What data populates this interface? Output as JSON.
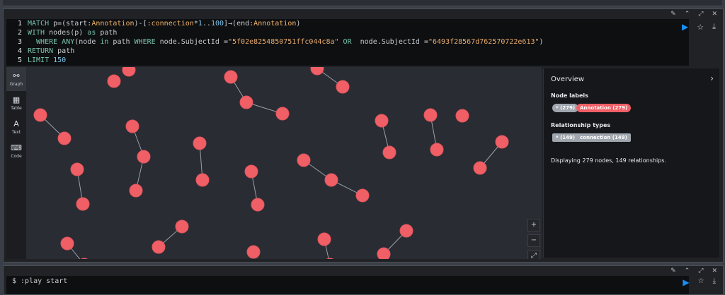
{
  "frame1": {
    "header_icons": [
      "pin-icon",
      "collapse-icon",
      "expand-icon",
      "close-icon"
    ],
    "code_lines": [
      {
        "num": "1",
        "tokens": [
          {
            "t": "kw",
            "v": "MATCH "
          },
          {
            "t": "txt",
            "v": "p=(start:"
          },
          {
            "t": "lbl",
            "v": "Annotation"
          },
          {
            "t": "txt",
            "v": ")-[:"
          },
          {
            "t": "lbl",
            "v": "connection"
          },
          {
            "t": "txt",
            "v": "*"
          },
          {
            "t": "numv",
            "v": "1"
          },
          {
            "t": "txt",
            "v": ".."
          },
          {
            "t": "numv",
            "v": "100"
          },
          {
            "t": "txt",
            "v": "]→(end:"
          },
          {
            "t": "lbl",
            "v": "Annotation"
          },
          {
            "t": "txt",
            "v": ")"
          }
        ]
      },
      {
        "num": "2",
        "tokens": [
          {
            "t": "kw",
            "v": "WITH "
          },
          {
            "t": "txt",
            "v": "nodes(p) "
          },
          {
            "t": "kw",
            "v": "as "
          },
          {
            "t": "txt",
            "v": "path"
          }
        ]
      },
      {
        "num": "3",
        "tokens": [
          {
            "t": "kw",
            "v": "  WHERE ANY"
          },
          {
            "t": "txt",
            "v": "(node "
          },
          {
            "t": "kw",
            "v": "in "
          },
          {
            "t": "txt",
            "v": "path "
          },
          {
            "t": "kw",
            "v": "WHERE "
          },
          {
            "t": "txt",
            "v": "node.SubjectId ="
          },
          {
            "t": "str",
            "v": "\"5f02e8254850751ffc044c8a\""
          },
          {
            "t": "kw",
            "v": " OR "
          },
          {
            "t": "txt",
            "v": " node.SubjectId ="
          },
          {
            "t": "str",
            "v": "\"6493f28567d762570722e613\""
          },
          {
            "t": "txt",
            "v": ")"
          }
        ]
      },
      {
        "num": "4",
        "tokens": [
          {
            "t": "kw",
            "v": "RETURN "
          },
          {
            "t": "txt",
            "v": "path"
          }
        ]
      },
      {
        "num": "5",
        "tokens": [
          {
            "t": "kw",
            "v": "LIMIT "
          },
          {
            "t": "numv",
            "v": "150"
          }
        ]
      }
    ],
    "actions": {
      "run": "▶",
      "favorite": "☆",
      "download": "⤓"
    },
    "tabs": [
      {
        "label": "Graph",
        "icon": "⚯",
        "active": true
      },
      {
        "label": "Table",
        "icon": "▦",
        "active": false
      },
      {
        "label": "Text",
        "icon": "A",
        "active": false
      },
      {
        "label": "Code",
        "icon": "⌨",
        "active": false
      }
    ],
    "zoom": {
      "zoom_in": "+",
      "zoom_out": "−",
      "fit": "⤢"
    },
    "overview": {
      "title": "Overview",
      "node_labels_title": "Node labels",
      "node_label_all": "* (279)",
      "node_label_annotation": "Annotation (279)",
      "rel_types_title": "Relationship types",
      "rel_all": "* (149)",
      "rel_connection": "connection (149)",
      "status": "Displaying 279 nodes, 149 relationships.",
      "colors": {
        "node": "#f05f66",
        "pill_gray": "#a0a6ae"
      }
    }
  },
  "frame2": {
    "command": "$ :play start"
  }
}
